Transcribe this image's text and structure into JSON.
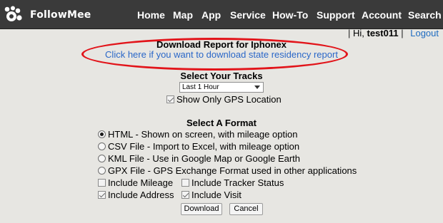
{
  "brand": {
    "name": "FollowMee"
  },
  "nav": {
    "items": [
      {
        "label": "Home"
      },
      {
        "label": "Map"
      },
      {
        "label": "App"
      },
      {
        "label": "Service"
      },
      {
        "label": "How-To"
      },
      {
        "label": "Support"
      },
      {
        "label": "Account"
      },
      {
        "label": "Search"
      }
    ]
  },
  "user": {
    "greeting": "Hi,",
    "username": "test011",
    "logout_label": "Logout",
    "separator": "|"
  },
  "report": {
    "title": "Download Report for Iphonex",
    "link_text": "Click here if you want to download state residency report",
    "annotation_color": "#e2141a"
  },
  "tracks": {
    "heading": "Select Your Tracks",
    "selected_range": "Last 1 Hour",
    "gps_only_label": "Show Only GPS Location",
    "gps_only_checked": true
  },
  "format": {
    "heading": "Select A Format",
    "options": [
      {
        "label": "HTML - Shown on screen, with mileage option",
        "selected": true
      },
      {
        "label": "CSV File - Import to Excel, with mileage option",
        "selected": false
      },
      {
        "label": "KML File - Use in Google Map or Google Earth",
        "selected": false
      },
      {
        "label": "GPX File - GPS Exchange Format used in other applications",
        "selected": false
      }
    ],
    "extras": [
      {
        "label": "Include Mileage",
        "checked": false
      },
      {
        "label": "Include Tracker Status",
        "checked": false
      },
      {
        "label": "Include Address",
        "checked": true
      },
      {
        "label": "Include Visit",
        "checked": true
      }
    ]
  },
  "actions": {
    "download_label": "Download",
    "cancel_label": "Cancel"
  },
  "colors": {
    "header_bg": "#3a3a3a",
    "page_bg": "#e7e6e2",
    "link": "#2a67c8"
  }
}
